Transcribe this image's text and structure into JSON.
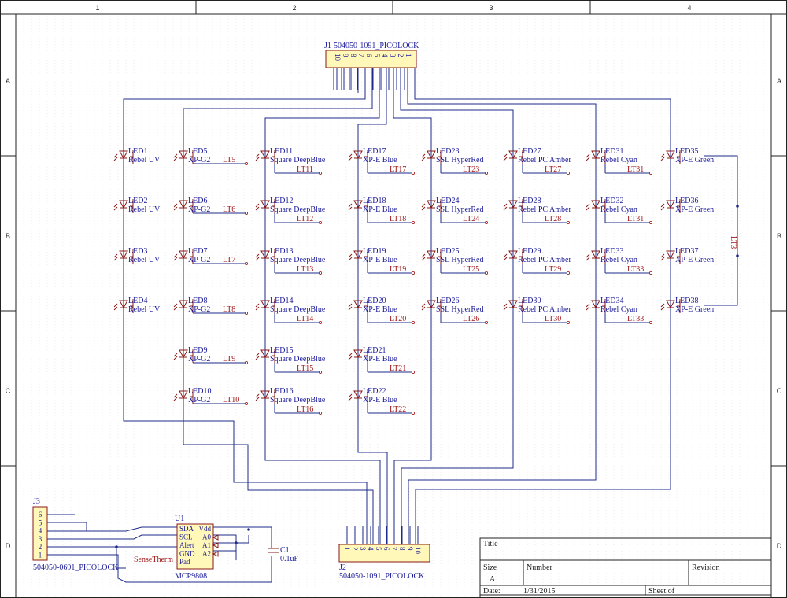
{
  "zones": {
    "columns": [
      "1",
      "2",
      "3",
      "4"
    ],
    "rows": [
      "A",
      "B",
      "C",
      "D"
    ]
  },
  "j1": {
    "designator": "J1",
    "part": "504050-1091_PICOLOCK",
    "pins": [
      "10",
      "9",
      "8",
      "7",
      "6",
      "5",
      "4",
      "3",
      "2",
      "1"
    ]
  },
  "j2": {
    "designator": "J2",
    "part": "504050-1091_PICOLOCK",
    "pins": [
      "1",
      "2",
      "3",
      "4",
      "5",
      "6",
      "7",
      "8",
      "9",
      "10"
    ]
  },
  "j3": {
    "designator": "J3",
    "part": "504050-0691_PICOLOCK",
    "pins": [
      "6",
      "5",
      "4",
      "3",
      "2",
      "1"
    ]
  },
  "u1": {
    "designator": "U1",
    "part": "MCP9808",
    "pins_left": [
      "SDA",
      "SCL",
      "Alert",
      "GND",
      "Pad"
    ],
    "pins_right": [
      "Vdd",
      "A0",
      "A1",
      "A2"
    ]
  },
  "c1": {
    "designator": "C1",
    "value": "0.1uF"
  },
  "sense_net": "SenseTherm",
  "lt3_net": "LT3",
  "leds": [
    {
      "name": "LED1",
      "type": "Rebel UV",
      "net": ""
    },
    {
      "name": "LED2",
      "type": "Rebel UV",
      "net": ""
    },
    {
      "name": "LED3",
      "type": "Rebel UV",
      "net": ""
    },
    {
      "name": "LED4",
      "type": "Rebel UV",
      "net": ""
    },
    {
      "name": "LED5",
      "type": "XP-G2",
      "net": "LT5"
    },
    {
      "name": "LED6",
      "type": "XP-G2",
      "net": "LT6"
    },
    {
      "name": "LED7",
      "type": "XP-G2",
      "net": "LT7"
    },
    {
      "name": "LED8",
      "type": "XP-G2",
      "net": "LT8"
    },
    {
      "name": "LED9",
      "type": "XP-G2",
      "net": "LT9"
    },
    {
      "name": "LED10",
      "type": "XP-G2",
      "net": "LT10"
    },
    {
      "name": "LED11",
      "type": "Square DeepBlue",
      "net": "LT11"
    },
    {
      "name": "LED12",
      "type": "Square DeepBlue",
      "net": "LT12"
    },
    {
      "name": "LED13",
      "type": "Square DeepBlue",
      "net": "LT13"
    },
    {
      "name": "LED14",
      "type": "Square DeepBlue",
      "net": "LT14"
    },
    {
      "name": "LED15",
      "type": "Square DeepBlue",
      "net": "LT15"
    },
    {
      "name": "LED16",
      "type": "Square DeepBlue",
      "net": "LT16"
    },
    {
      "name": "LED17",
      "type": "XP-E Blue",
      "net": "LT17"
    },
    {
      "name": "LED18",
      "type": "XP-E Blue",
      "net": "LT18"
    },
    {
      "name": "LED19",
      "type": "XP-E Blue",
      "net": "LT19"
    },
    {
      "name": "LED20",
      "type": "XP-E Blue",
      "net": "LT20"
    },
    {
      "name": "LED21",
      "type": "XP-E Blue",
      "net": "LT21"
    },
    {
      "name": "LED22",
      "type": "XP-E Blue",
      "net": "LT22"
    },
    {
      "name": "LED23",
      "type": "SSL HyperRed",
      "net": "LT23"
    },
    {
      "name": "LED24",
      "type": "SSL HyperRed",
      "net": "LT24"
    },
    {
      "name": "LED25",
      "type": "SSL HyperRed",
      "net": "LT25"
    },
    {
      "name": "LED26",
      "type": "SSL HyperRed",
      "net": "LT26"
    },
    {
      "name": "LED27",
      "type": "Rebel PC Amber",
      "net": "LT27"
    },
    {
      "name": "LED28",
      "type": "Rebel PC Amber",
      "net": "LT28"
    },
    {
      "name": "LED29",
      "type": "Rebel PC Amber",
      "net": "LT29"
    },
    {
      "name": "LED30",
      "type": "Rebel PC Amber",
      "net": "LT30"
    },
    {
      "name": "LED31",
      "type": "Rebel Cyan",
      "net": "LT31"
    },
    {
      "name": "LED32",
      "type": "Rebel Cyan",
      "net": "LT31"
    },
    {
      "name": "LED33",
      "type": "Rebel Cyan",
      "net": "LT33"
    },
    {
      "name": "LED34",
      "type": "Rebel Cyan",
      "net": "LT33"
    },
    {
      "name": "LED35",
      "type": "XP-E Green",
      "net": ""
    },
    {
      "name": "LED36",
      "type": "XP-E Green",
      "net": ""
    },
    {
      "name": "LED37",
      "type": "XP-E Green",
      "net": ""
    },
    {
      "name": "LED38",
      "type": "XP-E Green",
      "net": ""
    }
  ],
  "title_block": {
    "title_label": "Title",
    "size_label": "Size",
    "size_value": "A",
    "number_label": "Number",
    "revision_label": "Revision",
    "date_label": "Date:",
    "date_value": "1/31/2015",
    "sheet_label": "Sheet    of"
  },
  "colors": {
    "wire": "#1e2a8a",
    "component": "#8a1818",
    "component_fill": "#fff8b8",
    "text": "#1a1a99",
    "net_label": "#a01818"
  }
}
